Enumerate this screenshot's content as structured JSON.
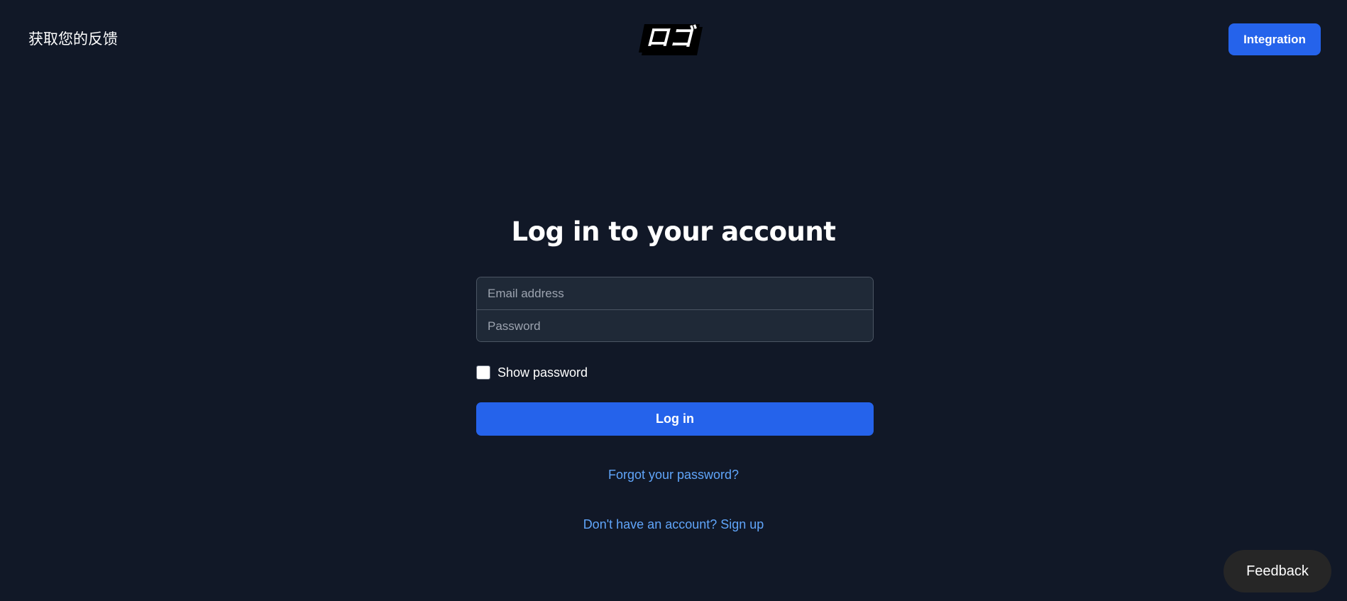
{
  "header": {
    "brand_text": "获取您的反馈",
    "logo_text": "ロゴ",
    "integration_label": "Integration"
  },
  "login": {
    "title": "Log in to your account",
    "email_placeholder": "Email address",
    "password_placeholder": "Password",
    "show_password_label": "Show password",
    "show_password_checked": false,
    "submit_label": "Log in",
    "forgot_link": "Forgot your password?",
    "signup_link": "Don't have an account? Sign up"
  },
  "feedback": {
    "label": "Feedback"
  },
  "colors": {
    "background": "#111827",
    "accent": "#2563eb",
    "link": "#60a5fa",
    "input_bg": "#1f2937"
  }
}
